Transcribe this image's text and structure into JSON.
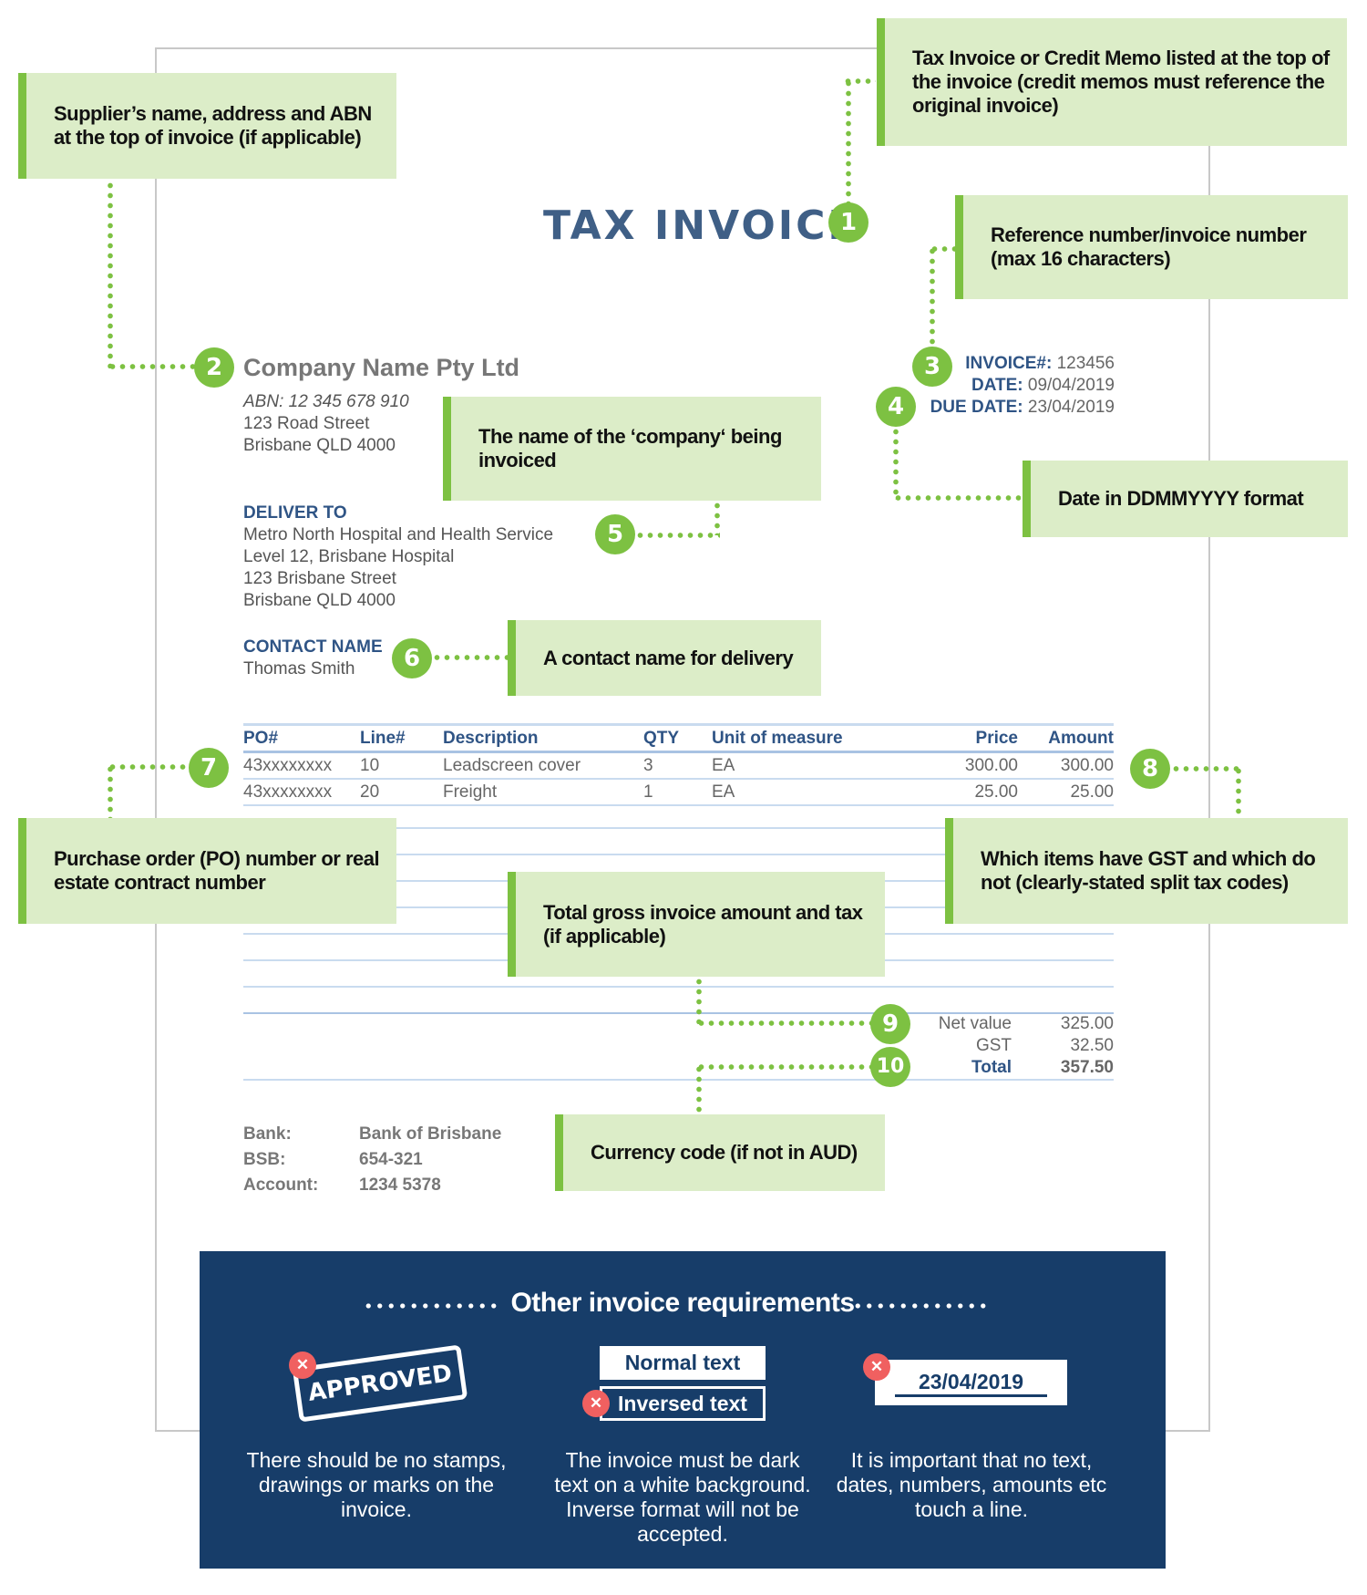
{
  "invoice": {
    "title": "TAX INVOICE",
    "supplier": {
      "company_name": "Company Name Pty Ltd",
      "abn": "ABN: 12 345 678 910",
      "address_line1": "123 Road Street",
      "address_line2": "Brisbane QLD 4000"
    },
    "meta": {
      "invoice_label": "INVOICE#:",
      "invoice_value": "123456",
      "date_label": "DATE:",
      "date_value": "09/04/2019",
      "due_label": "DUE DATE:",
      "due_value": "23/04/2019"
    },
    "deliver_to": {
      "label": "DELIVER TO",
      "lines": [
        "Metro North Hospital and Health Service",
        "Level 12, Brisbane Hospital",
        "123 Brisbane Street",
        "Brisbane QLD 4000"
      ]
    },
    "contact": {
      "label": "CONTACT NAME",
      "name": "Thomas Smith"
    },
    "table": {
      "headers": [
        "PO#",
        "Line#",
        "Description",
        "QTY",
        "Unit of measure",
        "Price",
        "Amount"
      ],
      "rows": [
        [
          "43xxxxxxxx",
          "10",
          "Leadscreen cover",
          "3",
          "EA",
          "300.00",
          "300.00"
        ],
        [
          "43xxxxxxxx",
          "20",
          "Freight",
          "1",
          "EA",
          "25.00",
          "25.00"
        ]
      ]
    },
    "totals": {
      "net_label": "Net value",
      "net_value": "325.00",
      "gst_label": "GST",
      "gst_value": "32.50",
      "total_label": "Total",
      "total_value": "357.50"
    },
    "bank": {
      "bank_label": "Bank:",
      "bank_value": "Bank of Brisbane",
      "bsb_label": "BSB:",
      "bsb_value": "654-321",
      "account_label": "Account:",
      "account_value": "1234 5378"
    }
  },
  "callouts": {
    "supplier": "Supplier’s name, address and ABN at the top of invoice (if applicable)",
    "tax_invoice": "Tax Invoice or Credit Memo listed at the top of the invoice (credit memos must reference the original invoice)",
    "reference": "Reference number/invoice number (max 16 characters)",
    "company_invoiced": "The name of the ‘company‘ being invoiced",
    "date_format": "Date in DDMMYYYY format",
    "contact": "A contact name for delivery",
    "po_number": "Purchase order (PO) number or real estate contract number",
    "gst": "Which items have GST and which do not (clearly-stated split tax codes)",
    "total_gross": "Total gross invoice amount and tax (if applicable)",
    "currency": "Currency code (if not in AUD)"
  },
  "badges": [
    "1",
    "2",
    "3",
    "4",
    "5",
    "6",
    "7",
    "8",
    "9",
    "10"
  ],
  "requirements": {
    "title": "Other invoice requirements",
    "items": [
      {
        "example": "APPROVED",
        "text": "There should be no stamps, drawings or marks on the invoice."
      },
      {
        "example_normal": "Normal text",
        "example_inversed": "Inversed text",
        "text": "The invoice must be dark text on a white background. Inverse format will not be accepted."
      },
      {
        "example": "23/04/2019",
        "text": "It is important that no text, dates, numbers, amounts etc touch a line."
      }
    ],
    "reject_icon": "x-mark"
  },
  "colors": {
    "accent_green": "#7dc142",
    "callout_bg": "#dcedc8",
    "heading_blue": "#3f5f86",
    "panel_navy": "#173d69",
    "reject_red": "#f06060"
  }
}
